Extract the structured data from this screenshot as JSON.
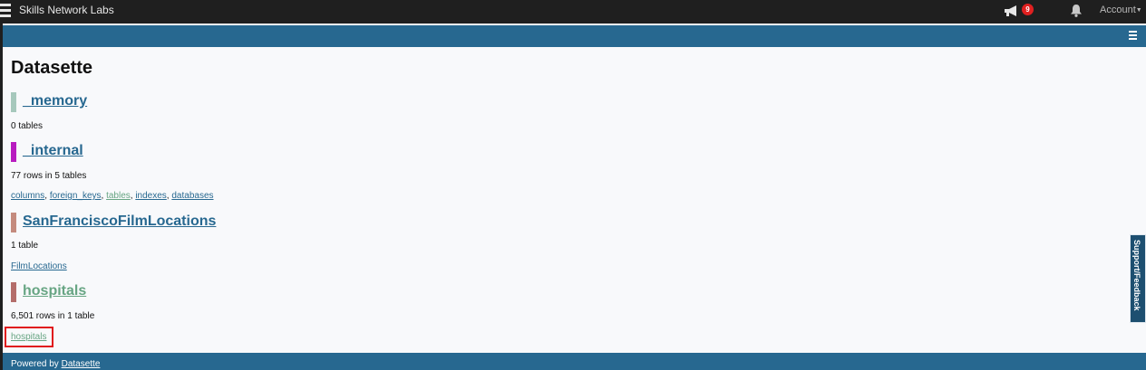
{
  "topbar": {
    "brand": "Skills Network Labs",
    "notification_count": "9",
    "account_label": "Account",
    "icons": [
      "menu-icon",
      "megaphone-icon",
      "bell-icon",
      "caret-down-icon"
    ]
  },
  "page": {
    "title": "Datasette"
  },
  "databases": [
    {
      "name": "_memory",
      "color": "#a6c8bc",
      "meta": "0 tables",
      "tables": []
    },
    {
      "name": "_internal",
      "color": "#b81cc0",
      "meta": "77 rows in 5 tables",
      "tables": [
        "columns",
        "foreign_keys",
        "tables",
        "indexes",
        "databases"
      ]
    },
    {
      "name": "SanFranciscoFilmLocations",
      "color": "#c48b7e",
      "meta": "1 table",
      "tables": [
        "FilmLocations"
      ]
    },
    {
      "name": "hospitals",
      "color": "#b46d6a",
      "meta": "6,501 rows in 1 table",
      "tables": [
        "hospitals"
      ]
    }
  ],
  "footer": {
    "powered_prefix": "Powered by",
    "powered_link": "Datasette"
  },
  "support_tab": {
    "label": "Support/Feedback"
  },
  "colors": {
    "topbar": "#1f1f1f",
    "header": "#276890",
    "link": "#276890",
    "visited_link": "#67a583",
    "highlight": "#e0181b"
  }
}
